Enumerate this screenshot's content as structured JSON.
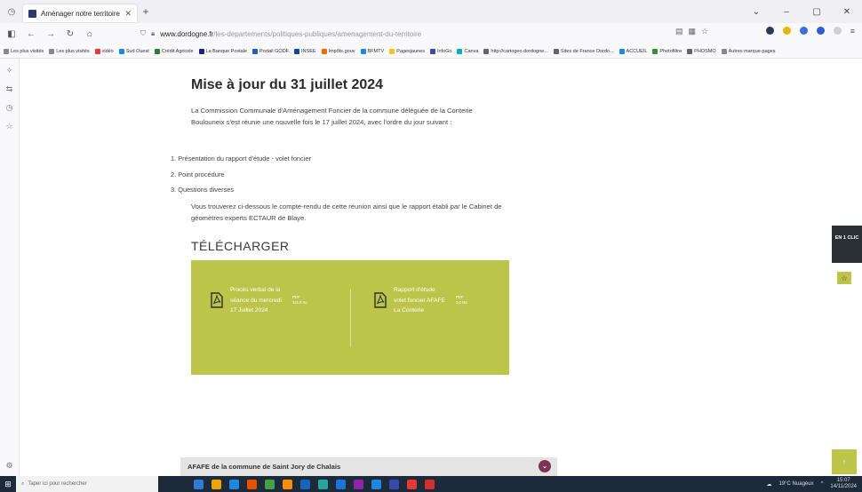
{
  "browser": {
    "tab_title": "Aménager notre territoire pour...",
    "url_domain": "www.dordogne.fr",
    "url_path": "/les-departements/politiques-publiques/amenagement-du-territoire",
    "bookmarks": [
      "Les plus visités",
      "Les plus visités",
      "vidéo",
      "Sud Ouest",
      "Crédit Agricole",
      "La Banque Postale",
      "Portail GODF",
      "INSEE",
      "Impôts.gouv",
      "BFMTV",
      "Pagesjaunes",
      "InfoGo",
      "Canva",
      "http://cartogeo.dordogne...",
      "Sites de France Dordo...",
      "ACCUEIL",
      "Photofiltre",
      "PHOSMO",
      "Autres marque-pages"
    ]
  },
  "page": {
    "heading": "Mise à jour du 31 juillet 2024",
    "intro": "La Commission Communale d'Aménagement Foncier de la commune déléguée de la Conterie Boulouneix s'est réunie une nouvelle fois le 17 juillet 2024, avec l'ordre du jour suivant :",
    "agenda": [
      "1. Présentation du rapport d'étude - volet foncier",
      "2. Point procédure",
      "3. Questions diverses"
    ],
    "outro": "Vous trouverez ci-dessous le compte-rendu de cette réunion ainsi que le rapport établi par le Cabinet de géomètres experts ECTAUR de Blaye.",
    "download_heading": "TÉLÉCHARGER",
    "files": [
      {
        "name": "Procès verbal de la séance du mercredi 17 Juillet 2024",
        "format": "PDF",
        "size": "321,9 Ko"
      },
      {
        "name": "Rapport d'étude volet foncier AFAFE La Conterie",
        "format": "PDF",
        "size": "3,0 Mo"
      }
    ],
    "side_cta": "EN 1 CLIC",
    "footer_section": "AFAFE de la commune de Saint Jory de Chalais"
  },
  "taskbar": {
    "search_placeholder": "Taper ici pour rechercher",
    "weather": "19°C Nuageux",
    "time": "15:07",
    "date": "14/11/2024"
  },
  "colors": {
    "accent_green": "#bcc54a",
    "dark_panel": "#2a3033",
    "plum": "#7b3357"
  }
}
